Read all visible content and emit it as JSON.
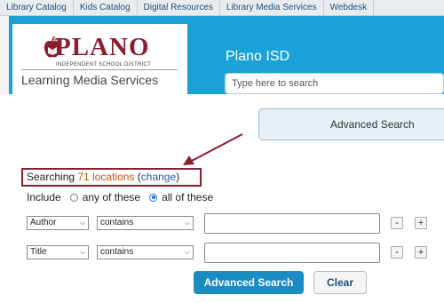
{
  "topnav": {
    "tabs": [
      "Library Catalog",
      "Kids Catalog",
      "Digital Resources",
      "Library Media Services",
      "Webdesk"
    ]
  },
  "header": {
    "logo_name": "PLANO",
    "logo_sub": "INDEPENDENT SCHOOL DISTRICT",
    "logo_dept": "Learning Media Services",
    "site_title": "Plano ISD",
    "search_placeholder": "Type here to search"
  },
  "advanced_heading": "Advanced Search",
  "searching": {
    "prefix": "Searching ",
    "count": "71 locations",
    "change_open": " (",
    "change": "change",
    "change_close": ")"
  },
  "include": {
    "label": "Include",
    "option_any": "any of these",
    "option_all": "all of these",
    "selected": "all"
  },
  "criteria": [
    {
      "field": "Author",
      "operator": "contains",
      "value": ""
    },
    {
      "field": "Title",
      "operator": "contains",
      "value": ""
    }
  ],
  "buttons": {
    "minus": "-",
    "plus": "+",
    "search": "Advanced Search",
    "clear": "Clear"
  },
  "colors": {
    "brand": "#8b1e2d",
    "header_blue": "#1aa2d8",
    "button_blue": "#1a8cc2",
    "location_count": "#c0501a"
  }
}
